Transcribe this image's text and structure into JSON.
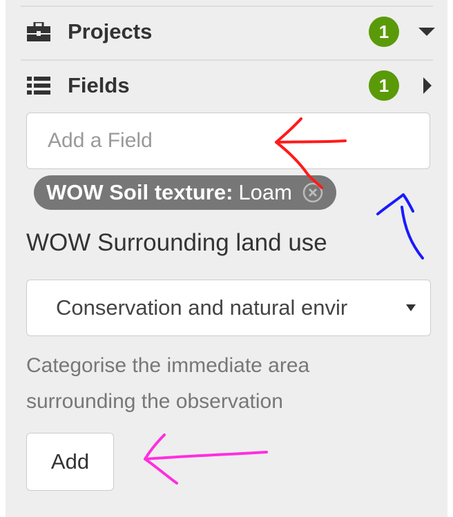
{
  "sidebar": {
    "projects": {
      "label": "Projects",
      "count": "1",
      "icon": "briefcase-icon",
      "caret": "caret-down-icon"
    },
    "fields": {
      "label": "Fields",
      "count": "1",
      "icon": "list-icon",
      "caret": "caret-right-icon"
    }
  },
  "field_input": {
    "placeholder": "Add a Field",
    "value": ""
  },
  "tag": {
    "key": "WOW Soil texture:",
    "value": "Loam",
    "remove_icon": "remove-circle-icon"
  },
  "surrounding_land_use": {
    "heading": "WOW Surrounding land use",
    "selected": "Conservation and natural envir",
    "help": "Categorise the immediate area surrounding the observation"
  },
  "add_button": {
    "label": "Add"
  },
  "colors": {
    "panel": "#eeeeee",
    "badge": "#5a9a08",
    "tag": "#777777",
    "annotation_red": "#ff1a1a",
    "annotation_blue": "#1a1aff",
    "annotation_magenta": "#ff2ee0"
  }
}
